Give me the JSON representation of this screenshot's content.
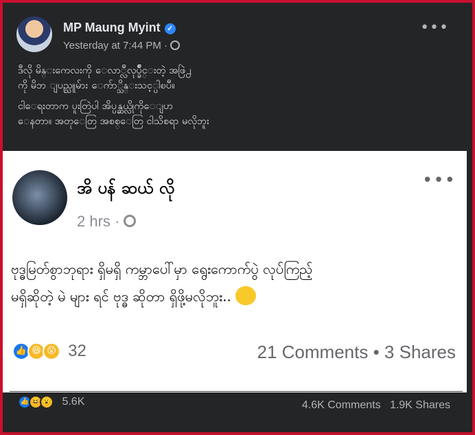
{
  "post": {
    "author": "MP Maung Myint",
    "time": "Yesterday at 7:44 PM",
    "separator": "·",
    "more_label": "•••",
    "caption_line1": "ဒီလို မိန္းကေလးကို ေလာ္လီလုပ္ခ်ိဳင္းတဲ့ အဖြဲ႕",
    "caption_line2": "ကို မိဘ ျပည္သူမ်ား ေက်ာ္သိန္းသင့္ပါၿပီ။",
    "caption_line3": "ငါေရးတာက ပူးတြဲပါ  အိပ္ပန္ဆယ္လိုကိုေျပာ",
    "caption_line4": "ေနတာ။ အတုေတြ အစစ္ေတြ ငါသိစရာ မလိုဘူး",
    "reaction_count": "5.6K",
    "comments": "4.6K Comments",
    "shares": "1.9K Shares"
  },
  "shared": {
    "author": "အိ ပန် ဆယ် လို",
    "time": "2 hrs",
    "separator": "·",
    "more_label": "•••",
    "body_line1": "ဗုဒ္ဓမြတ်စွာဘုရား ရှိမရှိ ကမ္ဘာပေါ်မှာ ရွေးကောက်ပွဲ လုပ်ကြည့်",
    "body_line2": "မရှိဆိုတဲ့ မဲ များ ရင် ဗုဒ္ဓ ဆိုတာ ရှိဖို့မလိုဘူး..",
    "reaction_count": "32",
    "comments": "21 Comments",
    "dot": "•",
    "shares": "3 Shares"
  },
  "icons": {
    "verified": "verified-badge-icon",
    "globe": "globe-icon",
    "like": "like-reaction-icon",
    "haha": "haha-reaction-icon",
    "wow": "wow-reaction-icon",
    "emoji": "winking-face-emoji-icon"
  },
  "colors": {
    "background": "#c8102e",
    "card": "#242526",
    "shared_card": "#ffffff",
    "accent": "#1877f2"
  }
}
